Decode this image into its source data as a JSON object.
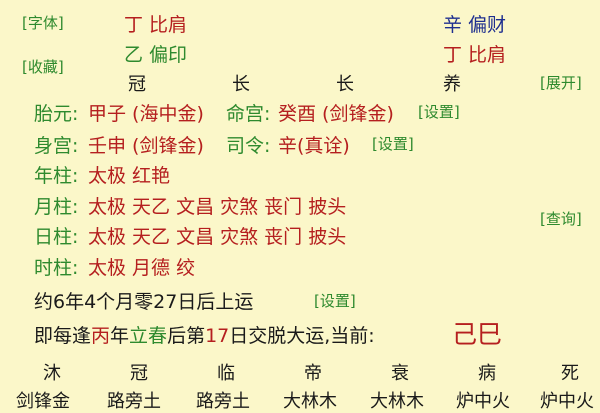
{
  "top_cut": [
    "",
    "",
    "",
    ""
  ],
  "left_buttons": {
    "font": "[字体]",
    "collect": "[收藏]"
  },
  "right_buttons": {
    "expand": "[展开]",
    "query": "[查询]"
  },
  "gods": {
    "col1_row1": "丁 比肩",
    "col1_row2": "乙 偏印",
    "col4_row1": "辛 偏财",
    "col4_row2": "丁 比肩"
  },
  "stages": [
    "冠",
    "长",
    "长",
    "养"
  ],
  "taiyuan": {
    "label": "胎元:",
    "value": "甲子 (海中金)"
  },
  "minggong": {
    "label": "命宫:",
    "value": "癸酉 (剑锋金)"
  },
  "shengong": {
    "label": "身宫:",
    "value": "壬申 (剑锋金)"
  },
  "siling": {
    "label": "司令:",
    "value": "辛(真诠)"
  },
  "set_label": "[设置]",
  "pillars": [
    {
      "label": "年柱:",
      "value": "太极 红艳"
    },
    {
      "label": "月柱:",
      "value": "太极 天乙 文昌 灾煞 丧门 披头"
    },
    {
      "label": "日柱:",
      "value": "太极 天乙 文昌 灾煞 丧门 披头"
    },
    {
      "label": "时柱:",
      "value": "太极 月德 绞"
    }
  ],
  "luck_start": "约6年4个月零27日后上运",
  "luck_line": {
    "prefix": "即每逢",
    "year_stem": "丙",
    "year_word": "年",
    "solar_term": "立春",
    "middle": "后第",
    "day_num": "17",
    "suffix": "日交脱大运,当前:",
    "current": "己巳"
  },
  "bottom_stages": [
    "沐",
    "冠",
    "临",
    "帝",
    "衰",
    "病",
    "死"
  ],
  "bottom_nayin": [
    "剑锋金",
    "路旁土",
    "路旁土",
    "大林木",
    "大林木",
    "炉中火",
    "炉中火"
  ]
}
